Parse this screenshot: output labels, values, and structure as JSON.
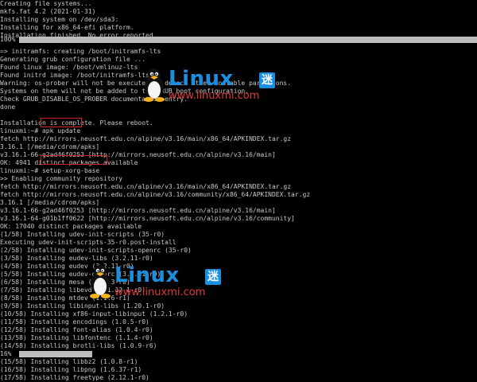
{
  "terminal": {
    "lines": [
      "Creating file systems...",
      "mkfs.fat 4.2 (2021-01-31)",
      "Installing system on /dev/sda3:",
      "Installing for x86_64-efi platform.",
      "Installation finished. No error reported.",
      "",
      "=> initramfs: creating /boot/initramfs-lts",
      "Generating grub configuration file ...",
      "Found linux image: /boot/vmlinuz-lts",
      "Found initrd image: /boot/initramfs-lts",
      "Warning: os-prober will not be executed to detect other bootable partitions.",
      "Systems on them will not be added to the GRUB boot configuration.",
      "Check GRUB_DISABLE_OS_PROBER documentation entry.",
      "done",
      "",
      "Installation is complete. Please reboot.",
      "linuxmi:~# apk update",
      "fetch http://mirrors.neusoft.edu.cn/alpine/v3.16/main/x86_64/APKINDEX.tar.gz",
      "3.16.1 [/media/cdrom/apks]",
      "v3.16.1-66-g2ad46f0253 [http://mirrors.neusoft.edu.cn/alpine/v3.16/main]",
      "OK: 4941 distinct packages available",
      "linuxmi:~# setup-xorg-base",
      ">> Enabling community repository",
      "fetch http://mirrors.neusoft.edu.cn/alpine/v3.16/main/x86_64/APKINDEX.tar.gz",
      "fetch http://mirrors.neusoft.edu.cn/alpine/v3.16/community/x86_64/APKINDEX.tar.gz",
      "3.16.1 [/media/cdrom/apks]",
      "v3.16.1-66-g2ad46f0253 [http://mirrors.neusoft.edu.cn/alpine/v3.16/main]",
      "v3.16.1-64-g01b1ff0622 [http://mirrors.neusoft.edu.cn/alpine/v3.16/community]",
      "OK: 17040 distinct packages available",
      "(1/58) Installing udev-init-scripts (35-r0)",
      "Executing udev-init-scripts-35-r0.post-install",
      "(2/58) Installing udev-init-scripts-openrc (35-r0)",
      "(3/58) Installing eudev-libs (3.2.11-r0)",
      "(4/58) Installing eudev (3.2.11-r0)",
      "(5/58) Installing eudev-openrc (3.2.11-r0)",
      "(6/58) Installing mesa (22.1.3-r0)",
      "(7/58) Installing libevdev (1.12.1-r0)",
      "(8/58) Installing mtdev (1.1.6-r1)",
      "(9/58) Installing libinput-libs (1.20.1-r0)",
      "(10/58) Installing xf86-input-libinput (1.2.1-r0)",
      "(11/58) Installing encodings (1.0.5-r0)",
      "(12/58) Installing font-alias (1.0.4-r0)",
      "(13/58) Installing libfontenc (1.1.4-r0)",
      "(14/58) Installing brotli-libs (1.0.9-r6)",
      "(15/58) Installing libbz2 (1.0.8-r1)",
      "(16/58) Installing libpng (1.6.37-r1)",
      "(17/58) Installing freetype (2.12.1-r0)"
    ],
    "progress_top": {
      "label": "100%",
      "fraction": 1.0
    },
    "progress_bottom": {
      "label": "16%",
      "fraction": 0.16
    }
  },
  "watermark": {
    "brand": "Linux",
    "brand_cn": "迷",
    "url": "www.linuxmi.com"
  },
  "colors": {
    "background": "#000000",
    "text": "#c8c8c8",
    "highlight_border": "#d02020",
    "watermark_blue": "#1a8fe0",
    "watermark_red": "#e03a3a"
  }
}
